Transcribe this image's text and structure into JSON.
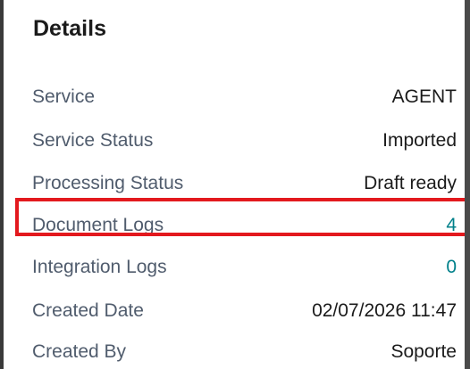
{
  "details": {
    "title": "Details",
    "rows": [
      {
        "label": "Service",
        "value": "AGENT"
      },
      {
        "label": "Service Status",
        "value": "Imported"
      },
      {
        "label": "Processing Status",
        "value": "Draft ready"
      },
      {
        "label": "Document Logs",
        "value": "4"
      },
      {
        "label": "Integration Logs",
        "value": "0"
      },
      {
        "label": "Created Date",
        "value": "02/07/2026 11:47"
      },
      {
        "label": "Created By",
        "value": "Soporte"
      }
    ]
  },
  "colors": {
    "label_text": "#505c6d",
    "value_text": "#1b1b1b",
    "link_text": "#00808a",
    "highlight_border": "#e3191e"
  }
}
